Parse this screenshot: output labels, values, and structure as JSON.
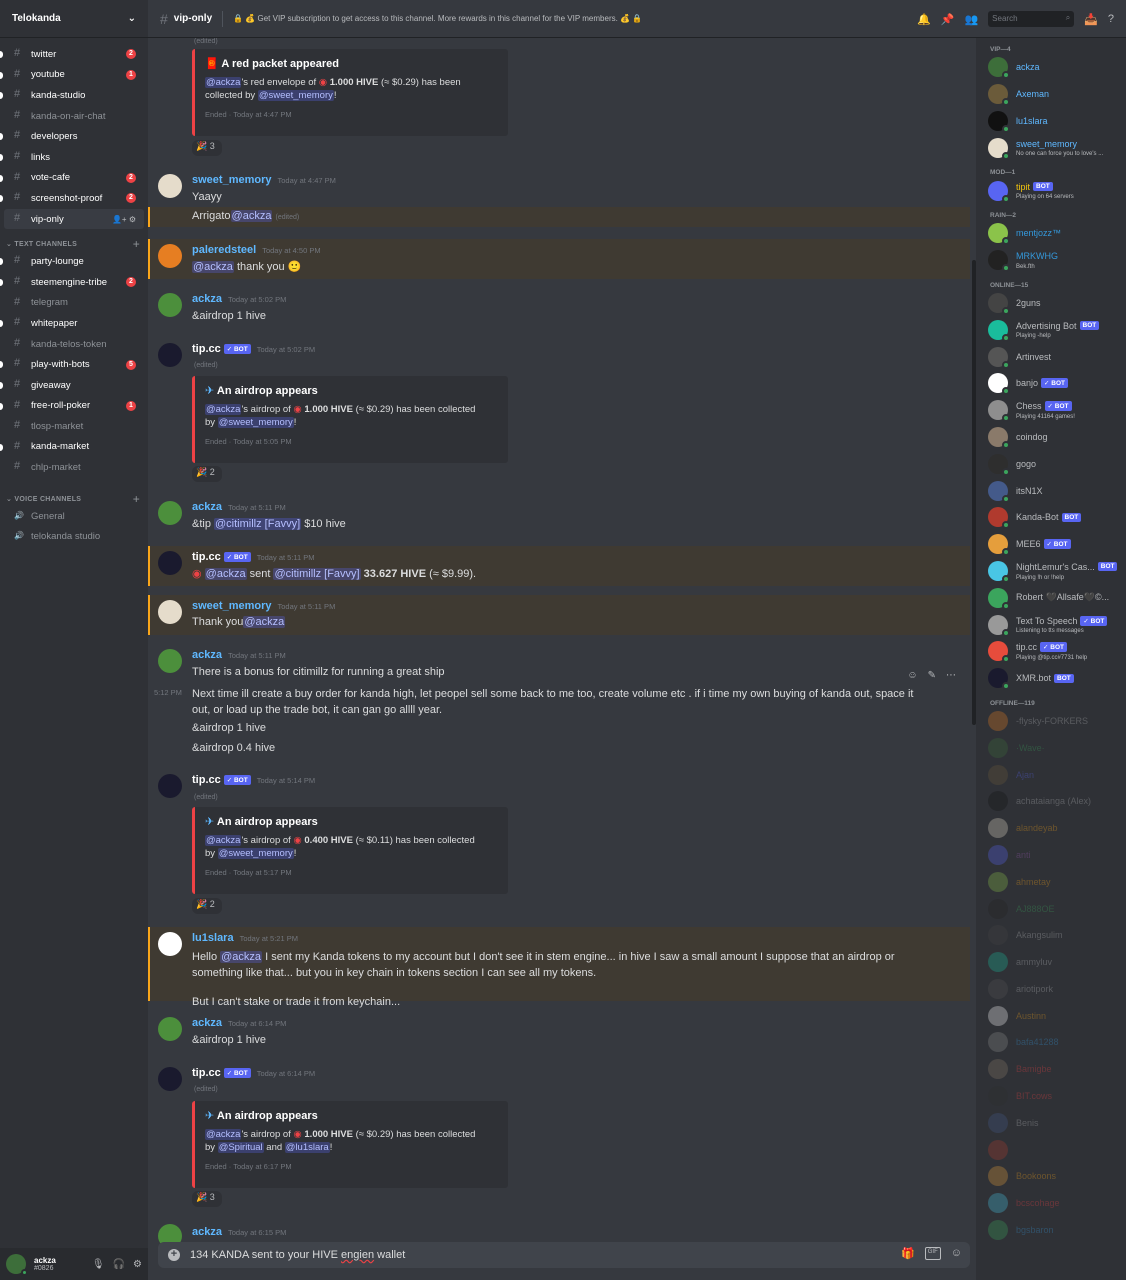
{
  "server": {
    "name": "Telokanda"
  },
  "channels": [
    {
      "label": "twitter",
      "badge": "2"
    },
    {
      "label": "youtube",
      "badge": "1"
    },
    {
      "label": "kanda-studio",
      "badge": ""
    },
    {
      "label": "kanda-on-air-chat",
      "badge": ""
    },
    {
      "label": "developers",
      "badge": ""
    },
    {
      "label": "links",
      "badge": ""
    },
    {
      "label": "vote-cafe",
      "badge": "2"
    },
    {
      "label": "screenshot-proof",
      "badge": "2"
    },
    {
      "label": "vip-only",
      "badge": ""
    }
  ],
  "text_category": "TEXT CHANNELS",
  "text_channels": [
    {
      "label": "party-lounge",
      "badge": ""
    },
    {
      "label": "steemengine-tribe",
      "badge": "2"
    },
    {
      "label": "telegram",
      "badge": ""
    },
    {
      "label": "whitepaper",
      "badge": ""
    },
    {
      "label": "kanda-telos-token",
      "badge": ""
    },
    {
      "label": "play-with-bots",
      "badge": "5"
    },
    {
      "label": "giveaway",
      "badge": ""
    },
    {
      "label": "free-roll-poker",
      "badge": "1"
    },
    {
      "label": "tlosp-market",
      "badge": ""
    },
    {
      "label": "kanda-market",
      "badge": ""
    },
    {
      "label": "chlp-market",
      "badge": ""
    }
  ],
  "voice_category": "VOICE CHANNELS",
  "voice_channels": [
    {
      "label": "General"
    },
    {
      "label": "telokanda studio"
    }
  ],
  "user": {
    "name": "ackza",
    "disc": "#0826"
  },
  "header": {
    "channel": "vip-only",
    "topic": "🔒 💰 Get VIP subscription to get access to this channel. More rewards in this channel for the VIP members. 💰 🔒",
    "search_placeholder": "Search"
  },
  "messages": {
    "m0": {
      "edited": "(edited)"
    },
    "e1": {
      "title": "A red packet appeared",
      "l1a": "@ackza",
      "l1b": "'s red envelope of ",
      "amt": "1.000 HIVE",
      "l1c": " (≈ $0.29) has been",
      "l2a": "collected by ",
      "l2b": "@sweet_memory",
      "l2c": "!",
      "footer": "Ended · Today at 4:47 PM",
      "react": "3"
    },
    "m1": {
      "name": "sweet_memory",
      "time": "Today at 4:47 PM",
      "t1": "Yaayy",
      "t2a": "Arrigato",
      "t2b": "@ackza",
      "t2c": "(edited)"
    },
    "m2": {
      "name": "paleredsteel",
      "time": "Today at 4:50 PM",
      "t1a": "@ackza",
      "t1b": " thank you 🙂"
    },
    "m3": {
      "name": "ackza",
      "time": "Today at 5:02 PM",
      "t1": "&airdrop 1 hive"
    },
    "m4": {
      "name": "tip.cc",
      "bot": "✓ BOT",
      "time": "Today at 5:02 PM",
      "edited": "(edited)"
    },
    "e2": {
      "title": "An airdrop appears",
      "l1a": "@ackza",
      "l1b": "'s airdrop of ",
      "amt": "1.000 HIVE",
      "l1c": " (≈ $0.29) has been collected",
      "l2a": "by ",
      "l2b": "@sweet_memory",
      "l2c": "!",
      "footer": "Ended · Today at 5:05 PM",
      "react": "2"
    },
    "m5": {
      "name": "ackza",
      "time": "Today at 5:11 PM",
      "t1a": "&tip ",
      "t1b": "@citimillz [Favvy]",
      "t1c": " $10 hive"
    },
    "m6": {
      "name": "tip.cc",
      "bot": "✓ BOT",
      "time": "Today at 5:11 PM",
      "t1a": "@ackza",
      "t1b": " sent ",
      "t1c": "@citimillz [Favvy]",
      "t1d": " 33.627 HIVE",
      "t1e": " (≈ $9.99)."
    },
    "m7": {
      "name": "sweet_memory",
      "time": "Today at 5:11 PM",
      "t1a": "Thank you",
      "t1b": "@ackza"
    },
    "m8": {
      "name": "ackza",
      "time": "Today at 5:11 PM",
      "t1": "There is a bonus for citimillz for running a great ship",
      "side_time": "5:12 PM",
      "t2": "Next time ill create a buy order for kanda high, let peopel sell some back to me too, create volume etc . if i time my own buying of kanda out, space it",
      "t3": "out, or load up the trade bot, it can gan go allll year.",
      "t4": "&airdrop 1 hive",
      "t5": "&airdrop 0.4 hive"
    },
    "m9": {
      "name": "tip.cc",
      "bot": "✓ BOT",
      "time": "Today at 5:14 PM",
      "edited": "(edited)"
    },
    "e3": {
      "title": "An airdrop appears",
      "l1a": "@ackza",
      "l1b": "'s airdrop of ",
      "amt": "0.400 HIVE",
      "l1c": " (≈ $0.11) has been collected",
      "l2a": "by ",
      "l2b": "@sweet_memory",
      "l2c": "!",
      "footer": "Ended · Today at 5:17 PM",
      "react": "2"
    },
    "m10": {
      "name": "lu1slara",
      "time": "Today at 5:21 PM",
      "t1a": "Hello ",
      "t1b": "@ackza",
      "t1c": "  I sent my Kanda tokens to my account but I don't see it in stem engine... in hive I saw a small amount I suppose that an airdrop or",
      "t2": "something like that... but you in key chain in tokens section I can see all my tokens.",
      "t3": "But I can't stake or trade it from keychain..."
    },
    "m11": {
      "name": "ackza",
      "time": "Today at 6:14 PM",
      "t1": "&airdrop 1 hive"
    },
    "m12": {
      "name": "tip.cc",
      "bot": "✓ BOT",
      "time": "Today at 6:14 PM",
      "edited": "(edited)"
    },
    "e4": {
      "title": "An airdrop appears",
      "l1a": "@ackza",
      "l1b": "'s airdrop of ",
      "amt": "1.000 HIVE",
      "l1c": " (≈ $0.29) has been collected",
      "l2a": "by ",
      "l2b": "@Spiritual",
      "l2m": " and ",
      "l2d": "@lu1slara",
      "l2c": "!",
      "footer": "Ended · Today at 6:17 PM",
      "react": "3"
    },
    "m13": {
      "name": "ackza",
      "time": "Today at 6:15 PM"
    }
  },
  "composer": {
    "v1": "134 KANDA sent to your HIVE ",
    "v2": "engien",
    "v3": " wallet",
    "gif": "GIF"
  },
  "members": {
    "vip_label": "VIP—4",
    "vip": [
      {
        "name": "ackza",
        "color": "#5fb8ff",
        "sub": ""
      },
      {
        "name": "Axeman",
        "color": "#5fb8ff",
        "sub": ""
      },
      {
        "name": "lu1slara",
        "color": "#5fb8ff",
        "sub": ""
      },
      {
        "name": "sweet_memory",
        "color": "#5fb8ff",
        "sub": "No one can force you to love's ..."
      }
    ],
    "mod_label": "MOD—1",
    "mod": [
      {
        "name": "tipit",
        "color": "#f1c40f",
        "sub": "Playing on 64 servers",
        "bot": "BOT"
      }
    ],
    "rain_label": "RAIN—2",
    "rain": [
      {
        "name": "mentjozz™",
        "color": "#3498db",
        "sub": ""
      },
      {
        "name": "MRKWHG",
        "color": "#3498db",
        "sub": "Bek.fth"
      }
    ],
    "online_label": "ONLINE—15",
    "online": [
      {
        "name": "2guns",
        "sub": "",
        "bot": ""
      },
      {
        "name": "Advertising Bot",
        "sub": "Playing -help",
        "bot": "BOT"
      },
      {
        "name": "Artinvest",
        "sub": "",
        "bot": ""
      },
      {
        "name": "banjo",
        "sub": "",
        "bot": "✓ BOT"
      },
      {
        "name": "Chess",
        "sub": "Playing 41164 games!",
        "bot": "✓ BOT"
      },
      {
        "name": "coindog",
        "sub": "",
        "bot": ""
      },
      {
        "name": "gogo",
        "sub": "",
        "bot": ""
      },
      {
        "name": "itsN1X",
        "sub": "",
        "bot": ""
      },
      {
        "name": "Kanda-Bot",
        "sub": "",
        "bot": "BOT"
      },
      {
        "name": "MEE6",
        "sub": "",
        "bot": "✓ BOT"
      },
      {
        "name": "NightLemur's Cas...",
        "sub": "Playing !h or !help",
        "bot": "BOT"
      },
      {
        "name": "Robert 🖤Allsafe🖤©...",
        "sub": "",
        "bot": ""
      },
      {
        "name": "Text To Speech",
        "sub": "Listening to tts messages",
        "bot": "✓ BOT"
      },
      {
        "name": "tip.cc",
        "sub": "Playing @tip.cc#7731 help",
        "bot": "✓ BOT"
      },
      {
        "name": "XMR.bot",
        "sub": "",
        "bot": "BOT"
      }
    ],
    "offline_label": "OFFLINE—119",
    "offline": [
      {
        "name": "-flysky-FORKERS",
        "color": "#b9bbbe"
      },
      {
        "name": "·Wave·",
        "color": "#3ba55d"
      },
      {
        "name": "Ajan",
        "color": "#5865f2"
      },
      {
        "name": "achataianga (Alex)",
        "color": "#b9bbbe"
      },
      {
        "name": "alandeyab",
        "color": "#faa61a"
      },
      {
        "name": "anti",
        "color": "#9b59b6"
      },
      {
        "name": "ahmetay",
        "color": "#faa61a"
      },
      {
        "name": "AJ888OE",
        "color": "#3ba55d"
      },
      {
        "name": "Akangsulim",
        "color": "#b9bbbe"
      },
      {
        "name": "ammyluv",
        "color": "#b9bbbe"
      },
      {
        "name": "ariotipork",
        "color": "#b9bbbe"
      },
      {
        "name": "Austinn",
        "color": "#faa61a"
      },
      {
        "name": "bafa41288",
        "color": "#3498db"
      },
      {
        "name": "Bamigbe",
        "color": "#ed4245"
      },
      {
        "name": "BIT.cows",
        "color": "#ed4245"
      },
      {
        "name": "Benis",
        "color": "#b9bbbe"
      },
      {
        "name": "",
        "color": "#b9bbbe"
      },
      {
        "name": "Bookoons",
        "color": "#faa61a"
      },
      {
        "name": "bcscohage",
        "color": "#ed4245"
      },
      {
        "name": "bgsbaron",
        "color": "#3498db"
      }
    ]
  }
}
